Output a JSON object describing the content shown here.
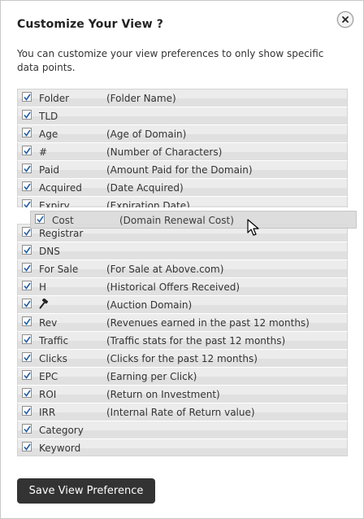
{
  "dialog": {
    "title": "Customize Your View ?",
    "description": "You can customize your view preferences to only show specific data points.",
    "close_icon": "close-icon"
  },
  "fields_top": [
    {
      "label": "Folder",
      "description": "(Folder Name)",
      "checked": true
    },
    {
      "label": "TLD",
      "description": "",
      "checked": true
    },
    {
      "label": "Age",
      "description": "(Age of Domain)",
      "checked": true
    },
    {
      "label": "#",
      "description": "(Number of Characters)",
      "checked": true
    },
    {
      "label": "Paid",
      "description": "(Amount Paid for the Domain)",
      "checked": true
    },
    {
      "label": "Acquired",
      "description": "(Date Acquired)",
      "checked": true
    },
    {
      "label": "Expiry",
      "description": "(Expiration Date)",
      "checked": true
    }
  ],
  "dragging_field": {
    "label": "Cost",
    "description": "(Domain Renewal Cost)",
    "checked": true
  },
  "fields_bottom": [
    {
      "label": "Registrar",
      "description": "",
      "checked": true
    },
    {
      "label": "DNS",
      "description": "",
      "checked": true
    },
    {
      "label": "For Sale",
      "description": "(For Sale at Above.com)",
      "checked": true
    },
    {
      "label": "H",
      "description": "(Historical Offers Received)",
      "checked": true
    },
    {
      "label": "",
      "icon": "gavel-icon",
      "description": "(Auction Domain)",
      "checked": true
    },
    {
      "label": "Rev",
      "description": "(Revenues earned in the past 12 months)",
      "checked": true
    },
    {
      "label": "Traffic",
      "description": "(Traffic stats for the past 12 months)",
      "checked": true
    },
    {
      "label": "Clicks",
      "description": "(Clicks for the past 12 months)",
      "checked": true
    },
    {
      "label": "EPC",
      "description": "(Earning per Click)",
      "checked": true
    },
    {
      "label": "ROI",
      "description": "(Return on Investment)",
      "checked": true
    },
    {
      "label": "IRR",
      "description": "(Internal Rate of Return value)",
      "checked": true
    },
    {
      "label": "Category",
      "description": "",
      "checked": true
    },
    {
      "label": "Keyword",
      "description": "",
      "checked": true
    }
  ],
  "buttons": {
    "save_label": "Save View Preference"
  }
}
